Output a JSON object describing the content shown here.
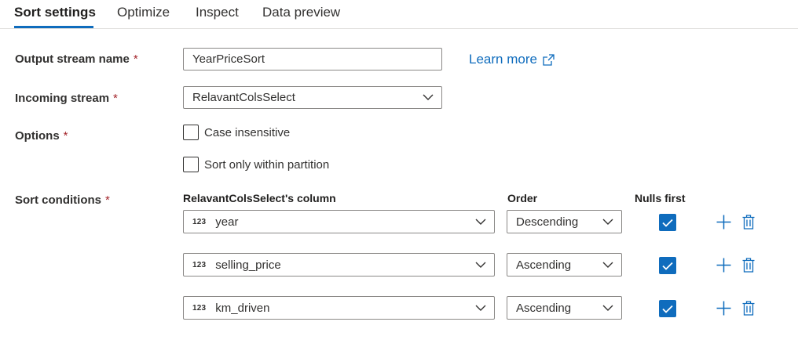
{
  "tabs": [
    {
      "label": "Sort settings",
      "active": true
    },
    {
      "label": "Optimize",
      "active": false
    },
    {
      "label": "Inspect",
      "active": false
    },
    {
      "label": "Data preview",
      "active": false
    }
  ],
  "accent_color": "#0f6cbd",
  "required_marker": "*",
  "output_stream": {
    "label": "Output stream name",
    "value": "YearPriceSort"
  },
  "learn_more": {
    "label": "Learn more",
    "icon": "external-link-icon"
  },
  "incoming_stream": {
    "label": "Incoming stream",
    "value": "RelavantColsSelect"
  },
  "options": {
    "label": "Options",
    "case_insensitive": {
      "label": "Case insensitive",
      "checked": false
    },
    "sort_within_partition": {
      "label": "Sort only within partition",
      "checked": false
    }
  },
  "sort_conditions": {
    "label": "Sort conditions",
    "headers": {
      "column": "RelavantColsSelect's column",
      "order": "Order",
      "nulls_first": "Nulls first"
    },
    "rows": [
      {
        "type_badge": "123",
        "column": "year",
        "order": "Descending",
        "nulls_first": true
      },
      {
        "type_badge": "123",
        "column": "selling_price",
        "order": "Ascending",
        "nulls_first": true
      },
      {
        "type_badge": "123",
        "column": "km_driven",
        "order": "Ascending",
        "nulls_first": true
      }
    ]
  }
}
